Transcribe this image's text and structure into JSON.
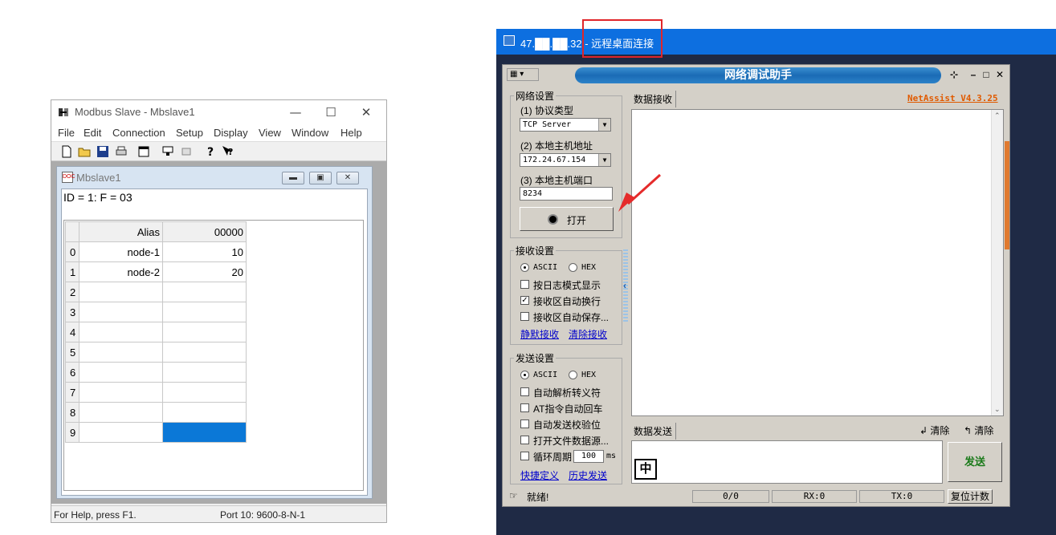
{
  "modbus": {
    "title": "Modbus Slave - Mbslave1",
    "menu": [
      "File",
      "Edit",
      "Connection",
      "Setup",
      "Display",
      "View",
      "Window",
      "Help"
    ],
    "child_title": "Mbslave1",
    "header_text": "ID = 1: F = 03",
    "columns": [
      "Alias",
      "00000"
    ],
    "rows": [
      {
        "index": "0",
        "alias": "node-1",
        "value": "10"
      },
      {
        "index": "1",
        "alias": "node-2",
        "value": "20"
      },
      {
        "index": "2",
        "alias": "",
        "value": ""
      },
      {
        "index": "3",
        "alias": "",
        "value": ""
      },
      {
        "index": "4",
        "alias": "",
        "value": ""
      },
      {
        "index": "5",
        "alias": "",
        "value": ""
      },
      {
        "index": "6",
        "alias": "",
        "value": ""
      },
      {
        "index": "7",
        "alias": "",
        "value": ""
      },
      {
        "index": "8",
        "alias": "",
        "value": ""
      },
      {
        "index": "9",
        "alias": "",
        "value": ""
      }
    ],
    "status_left": "For Help, press F1.",
    "status_right": "Port 10: 9600-8-N-1"
  },
  "remote": {
    "title": "47.██.██.32 - 远程桌面连接"
  },
  "netassist": {
    "title": "网络调试助手",
    "version": "NetAssist V4.3.25",
    "net_settings": {
      "label": "网络设置",
      "protocol_label": "(1) 协议类型",
      "protocol_value": "TCP Server",
      "host_label": "(2) 本地主机地址",
      "host_value": "172.24.67.154",
      "port_label": "(3) 本地主机端口",
      "port_value": "8234",
      "open_button": "打开"
    },
    "recv_settings": {
      "label": "接收设置",
      "ascii": "ASCII",
      "hex": "HEX",
      "opt1": "按日志模式显示",
      "opt2": "接收区自动换行",
      "opt3": "接收区自动保存...",
      "link1": "静默接收",
      "link2": "清除接收"
    },
    "send_settings": {
      "label": "发送设置",
      "ascii": "ASCII",
      "hex": "HEX",
      "opt1": "自动解析转义符",
      "opt2": "AT指令自动回车",
      "opt3": "自动发送校验位",
      "opt4": "打开文件数据源...",
      "opt5": "循环周期",
      "cycle_value": "100",
      "cycle_unit": "ms",
      "link1": "快捷定义",
      "link2": "历史发送"
    },
    "recv_tab": "数据接收",
    "send_tab": "数据发送",
    "clear1": "清除",
    "clear2": "清除",
    "ime": "中",
    "send_button": "发送",
    "status_ready": "就绪!",
    "count": "0/0",
    "rx": "RX:0",
    "tx": "TX:0",
    "reset": "复位计数"
  }
}
